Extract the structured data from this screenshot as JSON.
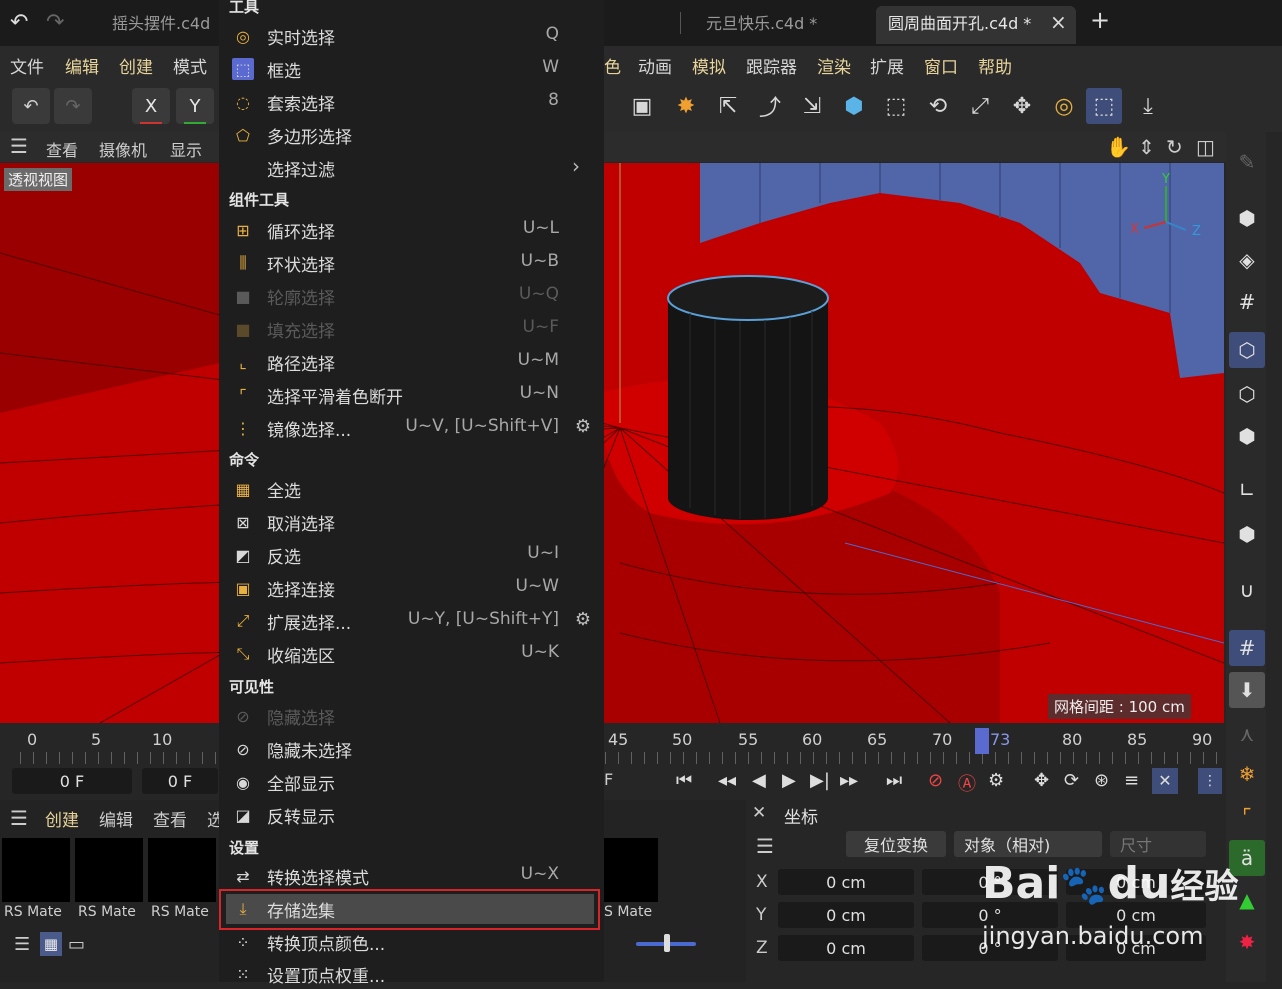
{
  "tabs": [
    {
      "label": "摇头摆件.c4d"
    },
    {
      "label": "元旦快乐.c4d *"
    },
    {
      "label": "圆周曲面开孔.c4d *"
    }
  ],
  "tab_close": "×",
  "tab_add": "+",
  "menubar": {
    "left": [
      "文件",
      "编辑",
      "创建",
      "模式"
    ],
    "right": [
      "色",
      "动画",
      "模拟",
      "跟踪器",
      "渲染",
      "扩展",
      "窗口",
      "帮助"
    ]
  },
  "axis_buttons": [
    "X",
    "Y"
  ],
  "view_header": [
    "查看",
    "摄像机",
    "显示"
  ],
  "viewport": {
    "label": "透视视图",
    "grid_spacing": "网格间距 : 100 cm",
    "axes": {
      "x": "X",
      "y": "Y",
      "z": "Z"
    },
    "colors": {
      "floor": "#c40000",
      "wall": "#5066a8",
      "object": "#141414"
    }
  },
  "timeline": {
    "ticks_left": [
      "0",
      "5",
      "10"
    ],
    "ticks_right": [
      "45",
      "50",
      "55",
      "60",
      "65",
      "70",
      "80",
      "85",
      "90"
    ],
    "current_frame": "73",
    "frame_start": "0 F",
    "frame_end": "0 F",
    "frame_partial": "F"
  },
  "bottom_left": {
    "menu": [
      "创建",
      "编辑",
      "查看",
      "选"
    ],
    "materials": [
      "RS Mate",
      "RS Mate",
      "RS Mate",
      "S Mate"
    ]
  },
  "coords_panel": {
    "title": "坐标",
    "reset_button": "复位变换",
    "mode_select": "对象（相对)",
    "size_select": "尺寸",
    "rows": [
      {
        "axis": "X",
        "value": "0 cm",
        "rot": "0 °",
        "size": "0 cm"
      },
      {
        "axis": "Y",
        "value": "0 cm",
        "rot": "0 °",
        "size": "0 cm"
      },
      {
        "axis": "Z",
        "value": "0 cm",
        "rot": "0 °",
        "size": "0 cm"
      }
    ]
  },
  "menu": {
    "sections": {
      "tools": "工具",
      "component_tools": "组件工具",
      "commands": "命令",
      "visibility": "可见性",
      "settings": "设置"
    },
    "tools": [
      {
        "label": "实时选择",
        "shortcut": "Q",
        "icon": "live-select-icon"
      },
      {
        "label": "框选",
        "shortcut": "W",
        "icon": "box-select-icon"
      },
      {
        "label": "套索选择",
        "shortcut": "8",
        "icon": "lasso-select-icon"
      },
      {
        "label": "多边形选择",
        "shortcut": "",
        "icon": "polygon-select-icon"
      },
      {
        "label": "选择过滤",
        "shortcut": "",
        "icon": "",
        "submenu": "›"
      }
    ],
    "component_tools": [
      {
        "label": "循环选择",
        "shortcut": "U~L"
      },
      {
        "label": "环状选择",
        "shortcut": "U~B"
      },
      {
        "label": "轮廓选择",
        "shortcut": "U~Q",
        "disabled": true
      },
      {
        "label": "填充选择",
        "shortcut": "U~F",
        "disabled": true
      },
      {
        "label": "路径选择",
        "shortcut": "U~M"
      },
      {
        "label": "选择平滑着色断开",
        "shortcut": "U~N"
      },
      {
        "label": "镜像选择...",
        "shortcut": "U~V, [U~Shift+V]",
        "gear": true
      }
    ],
    "commands": [
      {
        "label": "全选",
        "shortcut": ""
      },
      {
        "label": "取消选择",
        "shortcut": ""
      },
      {
        "label": "反选",
        "shortcut": "U~I"
      },
      {
        "label": "选择连接",
        "shortcut": "U~W"
      },
      {
        "label": "扩展选择...",
        "shortcut": "U~Y, [U~Shift+Y]",
        "gear": true
      },
      {
        "label": "收缩选区",
        "shortcut": "U~K"
      }
    ],
    "visibility": [
      {
        "label": "隐藏选择",
        "shortcut": "",
        "disabled": true
      },
      {
        "label": "隐藏未选择",
        "shortcut": ""
      },
      {
        "label": "全部显示",
        "shortcut": ""
      },
      {
        "label": "反转显示",
        "shortcut": ""
      }
    ],
    "settings": [
      {
        "label": "转换选择模式",
        "shortcut": "U~X"
      },
      {
        "label": "存储选集",
        "shortcut": "",
        "selected": true
      },
      {
        "label": "转换顶点颜色...",
        "shortcut": ""
      },
      {
        "label": "设置顶点权重...",
        "shortcut": ""
      }
    ]
  },
  "watermark": {
    "brand_a": "Bai",
    "brand_b": "du",
    "brand_c": "经验",
    "url": "jingyan.baidu.com"
  },
  "colors": {
    "accent": "#3f4d7a",
    "highlight_box": "#d8252a",
    "menu_bg": "#1e1e1e"
  }
}
